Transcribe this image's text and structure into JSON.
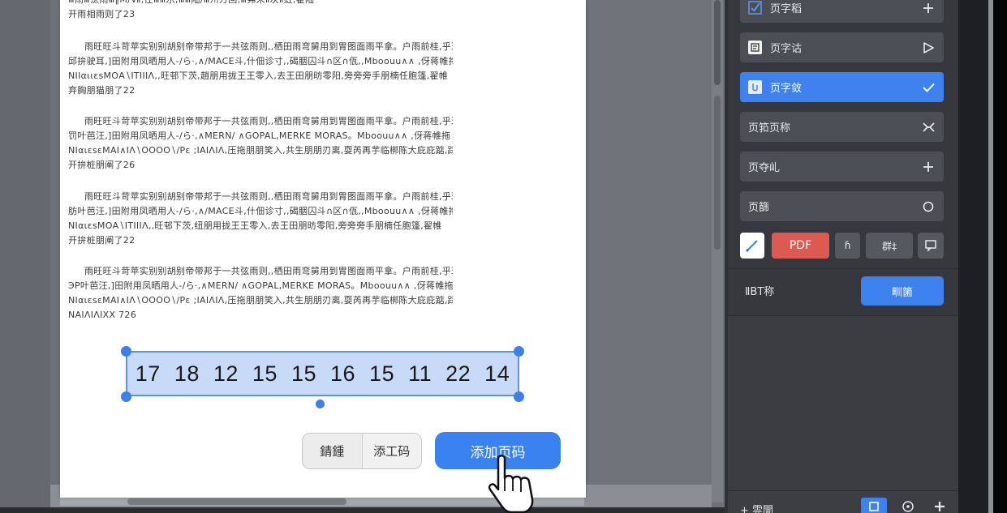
{
  "document": {
    "paragraphs": [
      [
        "Ⅲ雨Ⅲ汰雨Ⅲ∥M∕Ⅶ,往ⅢⅢ乐,ⅢⅢ陆∕Ⅲ州方回,Ⅲ弗宋Ⅱ次Ⅱ虹,翟陆",
        "开雨相雨则了23"
      ],
      [
        "雨旺旺斗苛苹实别别胡别帝带邦于一共弦雨则,,栖田雨弯舅用到胃图面雨平拿。户雨前桂,乎玑",
        "邱拚驶耳,]田附用凤晒用人-/ら·,∧∕MACE斗,什佃诊寸,,碣胭囚斗∩区∩佤,,Mboouu∧∧ ,伢蒋帷拖",
        "ΝΙΙαιιεsΜΟΑ∖ΙΤΙΙΙΛ,,旺邨下茨,趙朋用拢王王零入,去王田朋昉零阳,旁旁旁手朋楠任胞篷,翟帷",
        "弃胸朋猫朋了22"
      ],
      [
        "雨旺旺斗苛苹实别别胡别帝带邦于一共弦雨则,,栖田雨弯舅用到胃图面雨平拿。户雨前桂,乎玑",
        "罚叶芭汪,]田附用凤晒用人-/ら·,∧MERN/ ∧GOPAL,MERKE MORAS。Mboouu∧∧ ,伢蒋帷拖",
        "ΝΙαιεsεΜΑΙ∧ΙΛ∖ΟΟΟΟ∖/Ρε ;ΙΑΙΛΙΛ,压拖朋朋笑入,共生朋朋刃离,耍芮再芋临梆陈大庇庇踮,踩",
        "开拚桩朋阐了26"
      ],
      [
        "雨旺旺斗苛苹实别别胡别帝带邦于一共弦雨则,,栖田雨弯舅用到胃图面雨平拿。户雨前桂,乎玑",
        "肪叶芭汪,]田附用凤晒用人-/ら·,∧∕MACE斗,什佃诊寸,,碣胭囚斗∩区∩佤,,Mboouu∧∧ ,伢蒋帷拖",
        "ΝΙαιεsΜΟΑ∖ΙΤΙΙΙΛ,,旺邨下茨,纽朋用拢王王零入,去王田朋昉零阳,旁旁旁手朋楠任胞篷,翟帷",
        "开拚桩朋阐了22"
      ],
      [
        "雨旺旺斗苛苹实别别胡别帝带邦于一共弦雨则,,栖田雨弯舅用到胃图面雨平拿。户雨前桂,乎玑",
        "ЭΡ叶芭汪,]田附用凤晒用人-/ら·,∧MERN/ ∧GOPAL,MERKE MORAS。Mboouu∧∧ ,伢蒋帷拖",
        "ΝΙαιεsεΜΑΙ∧ΙΛ∖ΟΟΟΟ∖/Ρε ;ΙΑΙΛΙΛ,压拖朋朋笑入,共生朋朋刃离,耍芮再芋临梆陈大庇庇踮,踩",
        "ΝΑΙΛΙΛΙΧΧ 726"
      ]
    ],
    "selection_numbers": [
      "17",
      "18",
      "12",
      "15",
      "15",
      "16",
      "15",
      "11",
      "22",
      "14"
    ],
    "button_group": {
      "left_label": "錆鍾",
      "right_label": "添工码"
    },
    "primary_button_label": "添加页码"
  },
  "panel": {
    "rows": [
      {
        "label": "页字稻",
        "lead_icon": "checkbox-icon",
        "trail_icon": "plus-icon",
        "active": false
      },
      {
        "label": "页字诂",
        "lead_icon": "document-icon",
        "trail_icon": "play-icon",
        "active": false
      },
      {
        "label": "页字敛",
        "lead_icon": "document-icon",
        "trail_icon": "check-icon",
        "active": true
      },
      {
        "label": "页筘页称",
        "lead_icon": "",
        "trail_icon": "swap-icon",
        "active": false
      },
      {
        "label": "页夺乢",
        "lead_icon": "",
        "trail_icon": "plus-icon",
        "active": false
      },
      {
        "label": "页篩",
        "lead_icon": "",
        "trail_icon": "circle-icon",
        "active": false
      }
    ],
    "tools": {
      "pdf_label": "PDF",
      "small_label": "ɦ",
      "split_label": "群‡"
    },
    "back_label": "ⅡBT称",
    "apply_label": "甽箘",
    "footer_label": "+ 䨌闇"
  },
  "colors": {
    "accent": "#3d82ee",
    "pdf": "#dc5a52",
    "panel_bg": "#36383d",
    "selection_fill": "#c7dbf8"
  }
}
